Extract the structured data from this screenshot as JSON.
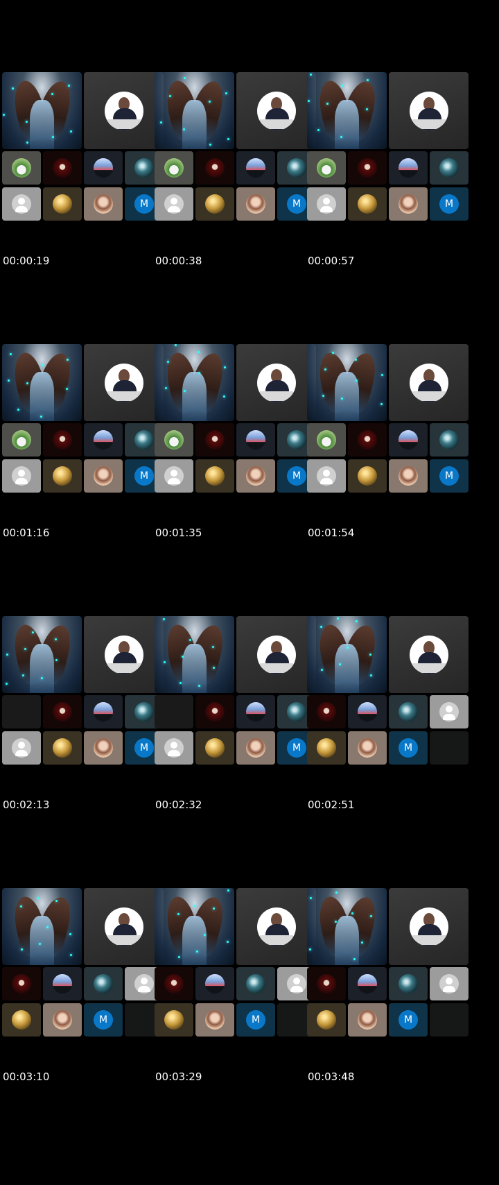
{
  "timestamps": [
    "00:00:19",
    "00:00:38",
    "00:00:57",
    "00:01:16",
    "00:01:35",
    "00:01:54",
    "00:02:13",
    "00:02:32",
    "00:02:51",
    "00:03:10",
    "00:03:29",
    "00:03:48"
  ],
  "participants": {
    "man": "participant-man-green",
    "red": "participant-red-portrait",
    "sil": "participant-silhouette",
    "earth": "participant-earth",
    "grey": "participant-default-avatar",
    "gold": "participant-gold",
    "beard": "participant-bearded-man",
    "m": "participant-m",
    "plain": "participant-camera-off",
    "empty": "empty-slot"
  },
  "initial_letter": "M",
  "layouts": {
    "a": [
      "man",
      "red",
      "sil",
      "earth",
      "grey",
      "gold",
      "beard",
      "m"
    ],
    "b": [
      "plain",
      "red",
      "sil",
      "earth",
      "grey",
      "gold",
      "beard",
      "m"
    ],
    "c": [
      "red",
      "sil",
      "earth",
      "grey",
      "gold",
      "beard",
      "m",
      "empty"
    ]
  },
  "frame_layouts": [
    "a",
    "a",
    "a",
    "a",
    "a",
    "a",
    "b",
    "b",
    "c",
    "c",
    "c",
    "c"
  ],
  "colors": {
    "background": "#000000",
    "accent": "#0a78c8"
  }
}
